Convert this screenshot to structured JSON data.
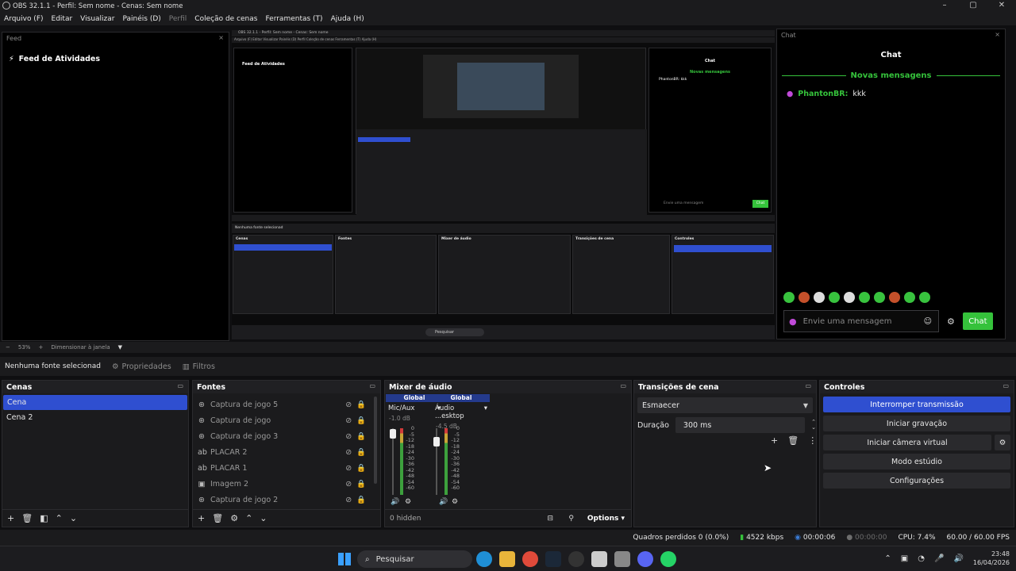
{
  "window": {
    "title": "OBS 32.1.1 - Perfil: Sem nome - Cenas: Sem nome"
  },
  "menu": [
    "Arquivo (F)",
    "Editar",
    "Visualizar",
    "Painéis (D)",
    "Perfil",
    "Coleção de cenas",
    "Ferramentas (T)",
    "Ajuda (H)"
  ],
  "feed": {
    "dock_title": "Feed",
    "heading": "Feed de Atividades"
  },
  "chat": {
    "dock_title": "Chat",
    "title": "Chat",
    "new_messages": "Novas mensagens",
    "user": "PhantonBR:",
    "text": "kkk",
    "placeholder": "Envie uma mensagem",
    "send": "Chat"
  },
  "zoom": {
    "level": "53%",
    "mode": "Dimensionar à janela"
  },
  "sourcebar": {
    "label": "Nenhuma fonte selecionad",
    "properties": "Propriedades",
    "filters": "Filtros"
  },
  "scenes": {
    "title": "Cenas",
    "items": [
      "Cena",
      "Cena 2"
    ]
  },
  "sources": {
    "title": "Fontes",
    "items": [
      {
        "name": "Captura de jogo 5",
        "icon": "gamepad-icon"
      },
      {
        "name": "Captura de jogo",
        "icon": "gamepad-icon"
      },
      {
        "name": "Captura de jogo 3",
        "icon": "gamepad-icon"
      },
      {
        "name": "PLACAR 2",
        "icon": "text-icon"
      },
      {
        "name": "PLACAR 1",
        "icon": "text-icon"
      },
      {
        "name": "Imagem 2",
        "icon": "image-icon"
      },
      {
        "name": "Captura de jogo 2",
        "icon": "gamepad-icon"
      }
    ]
  },
  "mixer": {
    "title": "Mixer de áudio",
    "hidden": "0 hidden",
    "options": "Options",
    "scale": [
      "0",
      "-5",
      "-12",
      "-18",
      "-24",
      "-30",
      "-36",
      "-42",
      "-48",
      "-54",
      "-60"
    ],
    "channels": [
      {
        "tag": "Global",
        "name": "Mic/Aux",
        "db": "-1.0 dB"
      },
      {
        "tag": "Global",
        "name": "Áudio ...esktop",
        "db": "-4.5 dB"
      }
    ]
  },
  "transitions": {
    "title": "Transições de cena",
    "selected": "Esmaecer",
    "duration_label": "Duração",
    "duration": "300 ms"
  },
  "controls": {
    "title": "Controles",
    "buttons": [
      "Interromper transmissão",
      "Iniciar gravação",
      "Iniciar câmera virtual",
      "Modo estúdio",
      "Configurações"
    ]
  },
  "status": {
    "dropped": "Quadros perdidos 0 (0.0%)",
    "bitrate": "4522 kbps",
    "stream_time": "00:00:06",
    "rec_time": "00:00:00",
    "cpu": "CPU: 7.4%",
    "fps": "60.00 / 60.00 FPS"
  },
  "taskbar": {
    "search": "Pesquisar",
    "time": "23:48",
    "date": "16/04/2026"
  },
  "preview_inner": {
    "title": "OBS 32.1.1 - Perfil: Sem nome - Cenas: Sem nome",
    "feed": "Feed de Atividades",
    "chat": "Chat",
    "new": "Novas mensagens",
    "msg": "PhantonBR: kkk",
    "placeholder": "Envie uma mensagem",
    "send": "Chat",
    "nosrc": "Nenhuma fonte selecionad",
    "scenes": "Cenas",
    "sources": "Fontes",
    "mixer": "Mixer de áudio",
    "transitions": "Transições de cena",
    "controls": "Controles",
    "search": "Pesquisar"
  },
  "colors": {
    "accent": "#2f4fd0",
    "chat_green": "#35c23b",
    "panel_bg": "#1b1b1d"
  }
}
